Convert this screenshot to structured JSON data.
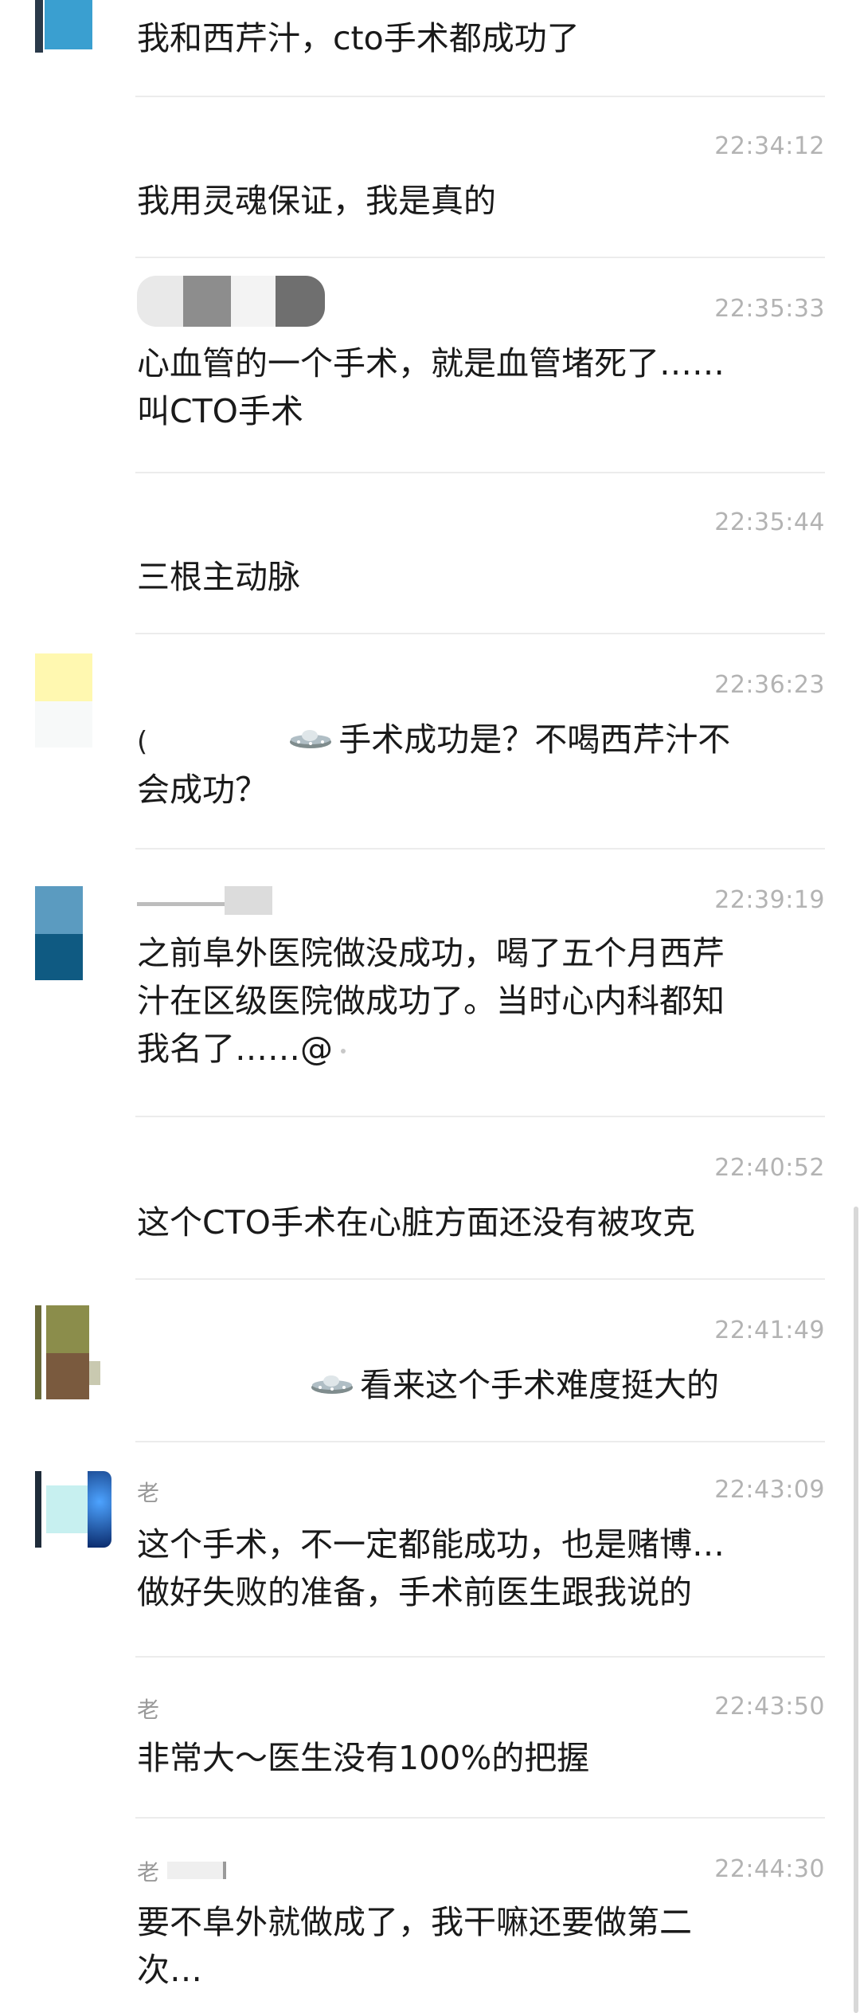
{
  "messages": [
    {
      "time": "",
      "text": "我和西芹汁，cto手术都成功了"
    },
    {
      "time": "22:34:12",
      "text": "我用灵魂保证，我是真的"
    },
    {
      "time": "22:35:33",
      "text": "心血管的一个手术，就是血管堵死了……\n叫CTO手术"
    },
    {
      "time": "22:35:44",
      "text": "三根主动脉"
    },
    {
      "time": "22:36:23",
      "prefix": "(",
      "text": "手术成功是？不喝西芹汁不\n会成功？"
    },
    {
      "time": "22:39:19",
      "text": "之前阜外医院做没成功，喝了五个月西芹\n汁在区级医院做成功了。当时心内科都知\n我名了……@"
    },
    {
      "time": "22:40:52",
      "text": "这个CTO手术在心脏方面还没有被攻克"
    },
    {
      "time": "22:41:49",
      "text": "看来这个手术难度挺大的"
    },
    {
      "time": "22:43:09",
      "name": "老",
      "text": "这个手术，不一定都能成功，也是赌博…\n做好失败的准备，手术前医生跟我说的"
    },
    {
      "time": "22:43:50",
      "name": "老",
      "text": "非常大～医生没有100%的把握"
    },
    {
      "time": "22:44:30",
      "name": "老",
      "text": "要不阜外就做成了，我干嘛还要做第二\n次…"
    }
  ],
  "icons": {
    "emoji": "ufo-emoji-icon"
  },
  "colors": {
    "background": "#ffffff",
    "text": "#1a1a1a",
    "timestamp": "#b3b3b3",
    "divider": "#ececec"
  }
}
